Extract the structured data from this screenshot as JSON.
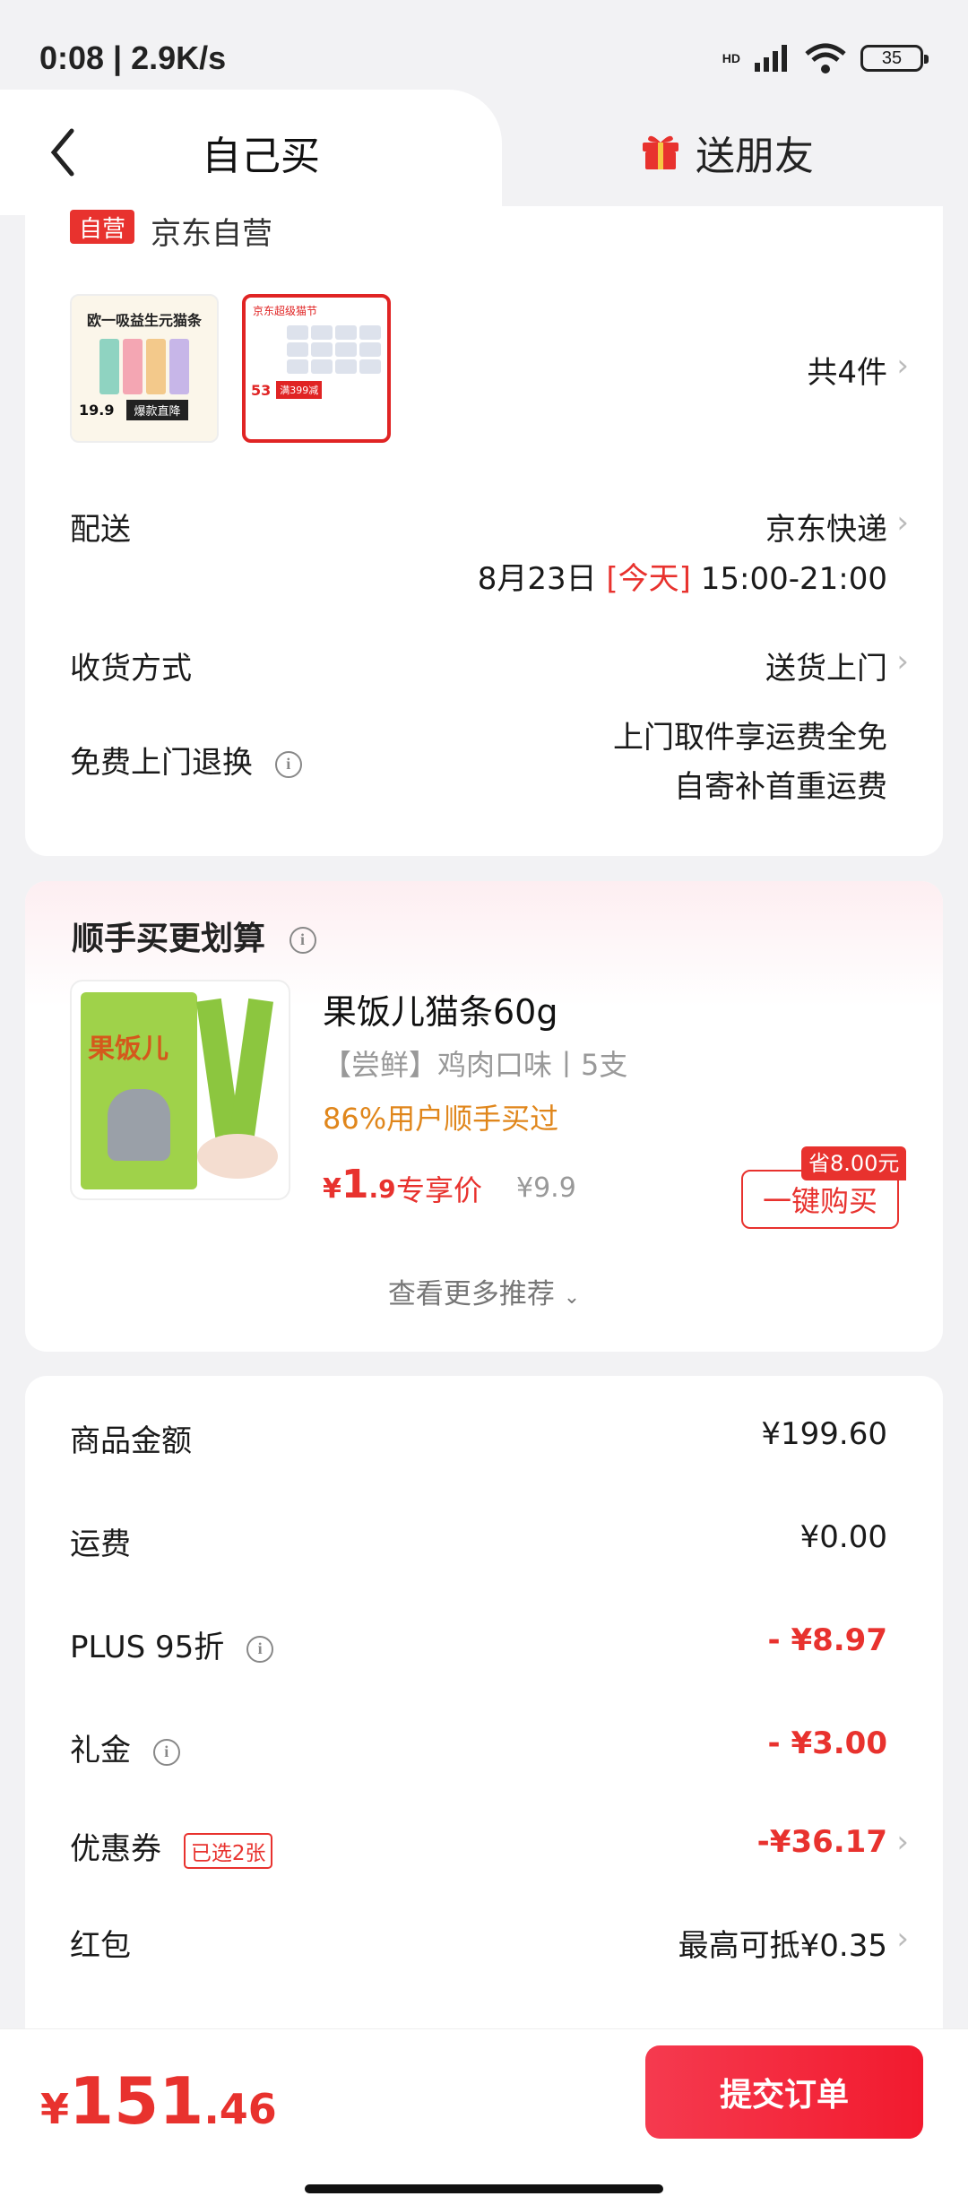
{
  "status_bar": {
    "time": "0:08 | 2.9K/s",
    "battery": "35",
    "network": "HD"
  },
  "tabs": {
    "self": "自己买",
    "friend": "送朋友"
  },
  "store": {
    "badge": "自营",
    "name": "京东自营"
  },
  "thumbs": [
    {
      "caption": "欧一吸益生元猫条",
      "price": "19.9",
      "tag": "爆款直降"
    },
    {
      "caption": "京东超级猫节",
      "price": "53",
      "promo": "满399减"
    }
  ],
  "items_count": "共4件",
  "delivery": {
    "label": "配送",
    "carrier": "京东快递",
    "date": "8月23日",
    "today": "[今天]",
    "window": "15:00-21:00"
  },
  "receive": {
    "label": "收货方式",
    "value": "送货上门"
  },
  "return": {
    "label": "免费上门退换",
    "line1": "上门取件享运费全免",
    "line2": "自寄补首重运费"
  },
  "recommend": {
    "title": "顺手买更划算",
    "name": "果饭儿猫条60g",
    "spec": "【尝鲜】鸡肉口味丨5支",
    "stat": "86%用户顺手买过",
    "price_cur": "¥",
    "price_int": "1",
    "price_dec": ".9",
    "price_label": "专享价",
    "original": "¥9.9",
    "save_tag": "省8.00元",
    "buy": "一键购买",
    "more": "查看更多推荐",
    "img_text": "果饭儿"
  },
  "fees": [
    {
      "label": "商品金额",
      "value": "¥199.60"
    },
    {
      "label": "运费",
      "value": "¥0.00"
    },
    {
      "label": "PLUS 95折",
      "value": "- ¥8.97"
    },
    {
      "label": "礼金",
      "value": "- ¥3.00"
    },
    {
      "label": "优惠券",
      "tag": "已选2张",
      "value": "-¥36.17"
    },
    {
      "label": "红包",
      "value": "最高可抵¥0.35"
    }
  ],
  "total": {
    "cur": "¥",
    "int": "151",
    "dec": ".46"
  },
  "submit": "提交订单",
  "colors": {
    "accent": "#e8322e",
    "orange": "#e0861b"
  }
}
